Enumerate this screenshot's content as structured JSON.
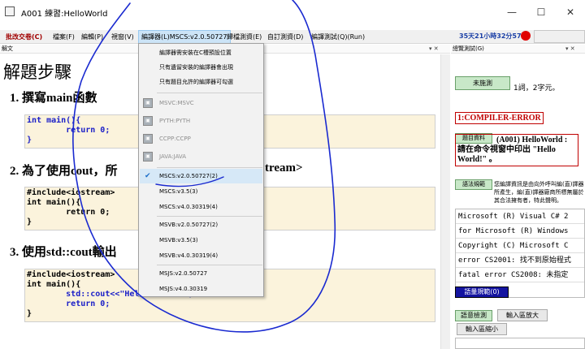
{
  "window": {
    "title": "A001 練習:HelloWorld",
    "minimize": "—",
    "maximize": "☐",
    "close": "✕"
  },
  "menubar": {
    "items": [
      {
        "label": "批改交卷(C)",
        "bold": true
      },
      {
        "label": "檔案(F)"
      },
      {
        "label": "編輯(P)"
      },
      {
        "label": "視窗(V)"
      },
      {
        "label": "編譯器(L)MSCS:v2.0.50727",
        "open": true
      },
      {
        "label": "歸檔測資(E)"
      },
      {
        "label": "自訂測資(D)"
      },
      {
        "label": "編譯測試(Q)(Run)"
      }
    ],
    "timer": "35天21小時32分57秒"
  },
  "left_panel": {
    "header": "解文",
    "pin": "▾ ✕",
    "heading": "解題步驟",
    "step1": "1. 撰寫main函數",
    "step2_prefix": "2. 為了使用cout，所",
    "step2_suffix": "tream>",
    "step3_prefix": "3. 使用std::cout輸出",
    "code1": [
      "int main(){",
      "        return 0;",
      "}"
    ],
    "code2": [
      "#include<iostream>",
      "int main(){",
      "        return 0;",
      "}"
    ],
    "code3_lines": [
      "#include<iostream>",
      "int main(){",
      "        std::cout<<\"Hello World!\";",
      "        return 0;",
      "}"
    ]
  },
  "dropdown": {
    "top_items": [
      "編譯器需安裝在C槽預設位置",
      "只有遺留安裝的編譯器會出現",
      "只有題目允許的編譯器可勾選"
    ],
    "disabled_items": [
      "MSVC:MSVC",
      "PYTH:PYTH",
      "CCPP:CCPP",
      "JAVA:JAVA"
    ],
    "icon_label": "▣",
    "check": "✔",
    "group_mscs": [
      "MSCS:v2.0.50727(2)",
      "MSCS:v3.5(3)",
      "MSCS:v4.0.30319(4)"
    ],
    "group_msvb": [
      "MSVB:v2.0.50727(2)",
      "MSVB:v3.5(3)",
      "MSVB:v4.0.30319(4)"
    ],
    "group_msjs": [
      "MSJS:v2.0.50727",
      "MSJS:v4.0.30319"
    ]
  },
  "right_panel": {
    "header": "總覽測試(G)",
    "pin": "▾ ✕",
    "status_button": "未施測",
    "status_text": "1詞，2字元。",
    "error_label": "1:COMPILER-ERROR",
    "problem_button": "題目資料",
    "problem_text": "(A001) HelloWorld : 請在命令視窗中印出 \"Hello World!\" 。",
    "syntax_button": "語法規範",
    "syntax_note": "您編譯資訊是由向外呼叫編(直)譯器所產生，編(直)譯器廠商所標無屬於其合法擁有者，特此聲明。",
    "console_lines": [
      "Microsoft (R) Visual C# 2",
      "for Microsoft (R) Windows",
      "Copyright (C) Microsoft C",
      "error CS2001: 找不到原始程式",
      "fatal error CS2008: 未指定"
    ],
    "rules_button": "語量規範(0)",
    "test_button": "語意檢測",
    "enlarge_button": "輸入區放大",
    "shrink_button": "輸入區縮小"
  },
  "colors": {
    "accent_blue": "#1c20c8",
    "error_red": "#c00000",
    "ink": "#1a2ad0",
    "code_bg": "#fbf3dc"
  }
}
